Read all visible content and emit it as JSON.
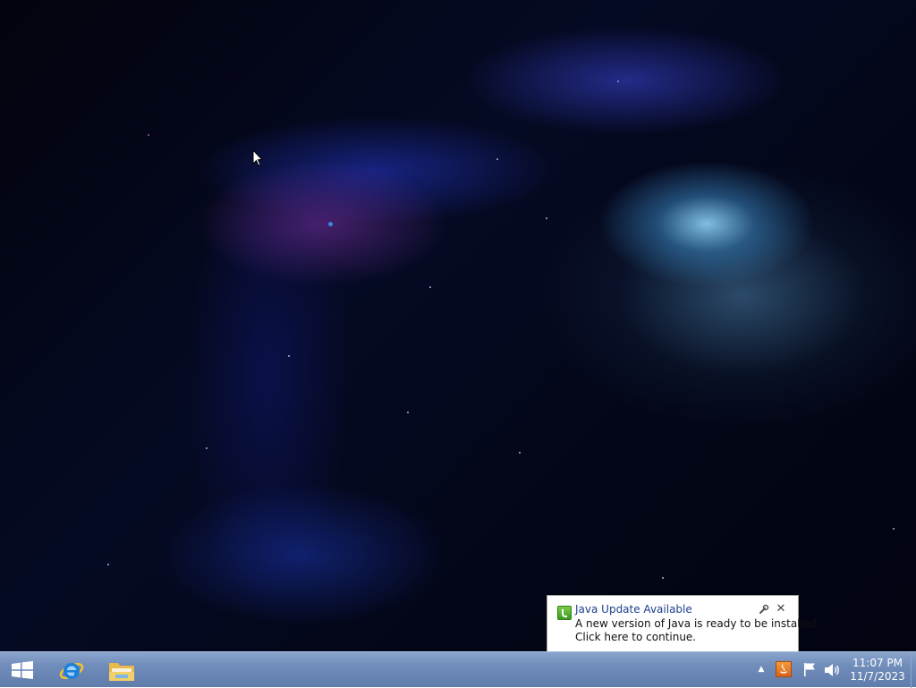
{
  "desktop": {
    "wallpaper": "blue nebula space wallpaper"
  },
  "notification": {
    "icon": "java-update-icon",
    "title": "Java Update Available",
    "message_line1": "A new version of Java is ready to be installed.",
    "message_line2": "Click here to continue.",
    "options_icon": "wrench-icon",
    "close_icon": "close-icon",
    "title_color": "#1e3f8c"
  },
  "taskbar": {
    "pinned": [
      {
        "name": "start-button",
        "icon": "windows-logo-icon"
      },
      {
        "name": "internet-explorer",
        "icon": "internet-explorer-icon"
      },
      {
        "name": "file-explorer",
        "icon": "folder-icon"
      }
    ],
    "tray": {
      "expand_glyph": "▲",
      "icons": [
        "java-icon",
        "action-center-flag-icon",
        "speaker-icon"
      ]
    },
    "clock": {
      "time": "11:07 PM",
      "date": "11/7/2023"
    },
    "color": "#6f8cba"
  }
}
